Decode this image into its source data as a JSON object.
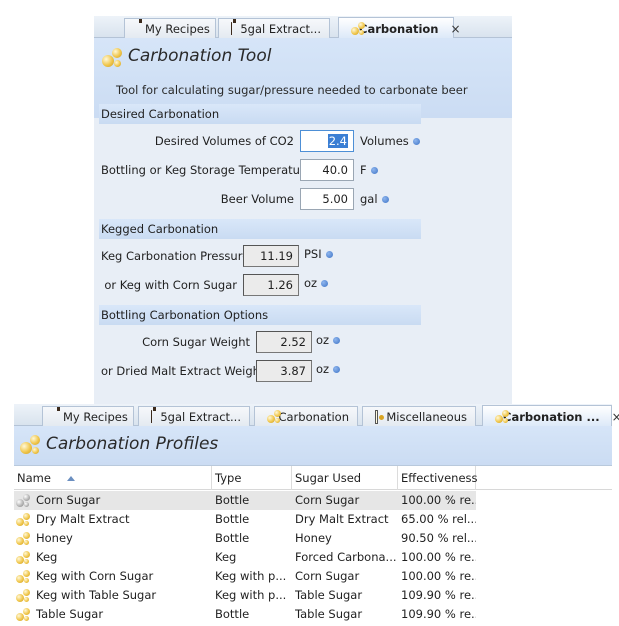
{
  "tool_panel": {
    "tabs": [
      {
        "label": "My Recipes",
        "icon": "bottle-icon"
      },
      {
        "label": "5gal Extract...",
        "icon": "bottle-icon"
      },
      {
        "label": "Carbonation",
        "icon": "bubbles-icon",
        "close": "×"
      }
    ],
    "title": "Carbonation Tool",
    "description": "Tool for calculating sugar/pressure needed to carbonate beer",
    "sections": {
      "desired": "Desired Carbonation",
      "kegged": "Kegged Carbonation",
      "bottling": "Bottling Carbonation Options"
    },
    "desired": {
      "volumes_label": "Desired Volumes of CO2",
      "volumes_value": "2.4",
      "volumes_unit": "Volumes",
      "temp_label": "Bottling or Keg Storage Temperature",
      "temp_value": "40.0",
      "temp_unit": "F",
      "beer_volume_label": "Beer Volume",
      "beer_volume_value": "5.00",
      "beer_volume_unit": "gal"
    },
    "kegged": {
      "pressure_label": "Keg Carbonation Pressure",
      "pressure_value": "11.19",
      "pressure_unit": "PSI",
      "corn_sugar_label": "or Keg with Corn Sugar",
      "corn_sugar_value": "1.26",
      "corn_sugar_unit": "oz"
    },
    "bottling": {
      "corn_sugar_label": "Corn Sugar Weight",
      "corn_sugar_value": "2.52",
      "corn_sugar_unit": "oz",
      "dme_label": "or Dried Malt Extract Weight",
      "dme_value": "3.87",
      "dme_unit": "oz"
    }
  },
  "profiles_panel": {
    "tabs": [
      {
        "label": "My Recipes",
        "icon": "bottle-icon"
      },
      {
        "label": "5gal Extract...",
        "icon": "bottle-icon"
      },
      {
        "label": "Carbonation",
        "icon": "bubbles-icon"
      },
      {
        "label": "Miscellaneous",
        "icon": "misc-icon"
      },
      {
        "label": "Carbonation ...",
        "icon": "bubbles-icon",
        "close": "×"
      }
    ],
    "title": "Carbonation Profiles",
    "columns": [
      "Name",
      "Type",
      "Sugar Used",
      "Effectiveness"
    ],
    "rows": [
      {
        "name": "Corn Sugar",
        "type": "Bottle",
        "sugar": "Corn Sugar",
        "effectiveness": "100.00 % re..."
      },
      {
        "name": "Dry Malt Extract",
        "type": "Bottle",
        "sugar": "Dry Malt Extract",
        "effectiveness": "65.00 % rel..."
      },
      {
        "name": "Honey",
        "type": "Bottle",
        "sugar": "Honey",
        "effectiveness": "90.50 % rel..."
      },
      {
        "name": "Keg",
        "type": "Keg",
        "sugar": "Forced Carbona...",
        "effectiveness": "100.00 % re..."
      },
      {
        "name": "Keg with Corn Sugar",
        "type": "Keg with p...",
        "sugar": "Corn Sugar",
        "effectiveness": "100.00 % re..."
      },
      {
        "name": "Keg with Table Sugar",
        "type": "Keg with p...",
        "sugar": "Table Sugar",
        "effectiveness": "109.90 % re..."
      },
      {
        "name": "Table Sugar",
        "type": "Bottle",
        "sugar": "Table Sugar",
        "effectiveness": "109.90 % re..."
      }
    ],
    "selected_row": 0
  },
  "colors": {
    "header_blue": "#cbdcf3",
    "panel_bg": "#e8eef6",
    "accent_dot": "#3d73c6",
    "selection": "#3b7fd4"
  }
}
